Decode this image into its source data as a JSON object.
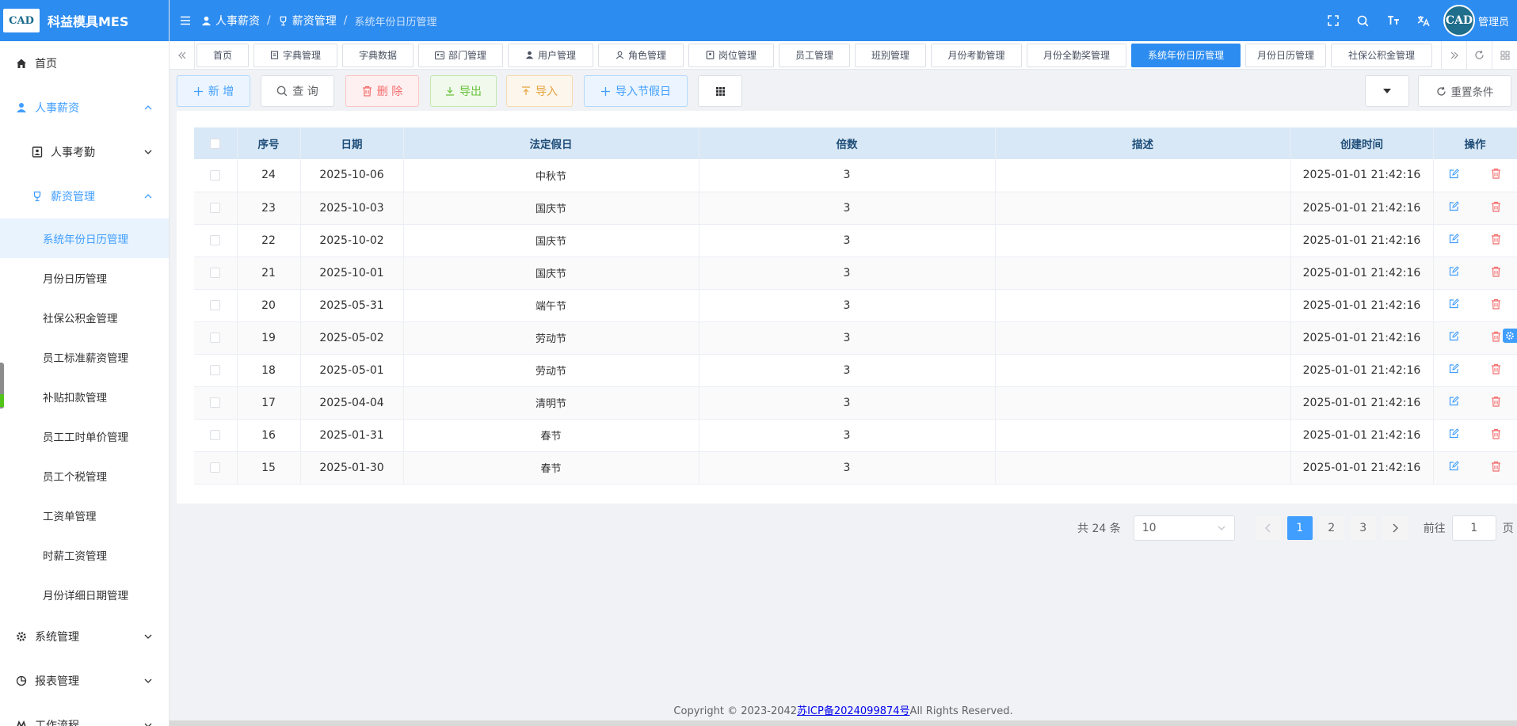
{
  "app": {
    "title": "科益模具MES",
    "logo_text": "CAD"
  },
  "sidebar": {
    "home": "首页",
    "hr_salary": "人事薪资",
    "hr_attendance": "人事考勤",
    "salary_mgmt": "薪资管理",
    "leaves": [
      "系统年份日历管理",
      "月份日历管理",
      "社保公积金管理",
      "员工标准薪资管理",
      "补贴扣款管理",
      "员工工时单价管理",
      "员工个税管理",
      "工资单管理",
      "时薪工资管理",
      "月份详细日期管理"
    ],
    "system_mgmt": "系统管理",
    "report_mgmt": "报表管理",
    "workflow": "工作流程"
  },
  "header": {
    "breadcrumb": [
      "人事薪资",
      "薪资管理",
      "系统年份日历管理"
    ],
    "admin": "管理员",
    "avatar_text": "CAD"
  },
  "tags": [
    "首页",
    "字典管理",
    "字典数据",
    "部门管理",
    "用户管理",
    "角色管理",
    "岗位管理",
    "员工管理",
    "班别管理",
    "月份考勤管理",
    "月份全勤奖管理",
    "系统年份日历管理",
    "月份日历管理",
    "社保公积金管理"
  ],
  "toolbar": {
    "add": "新 增",
    "query": "查 询",
    "delete": "删 除",
    "export": "导出",
    "import": "导入",
    "import_holiday": "导入节假日",
    "reset": "重置条件"
  },
  "table": {
    "columns": [
      "序号",
      "日期",
      "法定假日",
      "倍数",
      "描述",
      "创建时间",
      "操作"
    ],
    "rows": [
      {
        "no": "24",
        "date": "2025-10-06",
        "holiday": "中秋节",
        "mult": "3",
        "desc": "",
        "created": "2025-01-01 21:42:16"
      },
      {
        "no": "23",
        "date": "2025-10-03",
        "holiday": "国庆节",
        "mult": "3",
        "desc": "",
        "created": "2025-01-01 21:42:16"
      },
      {
        "no": "22",
        "date": "2025-10-02",
        "holiday": "国庆节",
        "mult": "3",
        "desc": "",
        "created": "2025-01-01 21:42:16"
      },
      {
        "no": "21",
        "date": "2025-10-01",
        "holiday": "国庆节",
        "mult": "3",
        "desc": "",
        "created": "2025-01-01 21:42:16"
      },
      {
        "no": "20",
        "date": "2025-05-31",
        "holiday": "端午节",
        "mult": "3",
        "desc": "",
        "created": "2025-01-01 21:42:16"
      },
      {
        "no": "19",
        "date": "2025-05-02",
        "holiday": "劳动节",
        "mult": "3",
        "desc": "",
        "created": "2025-01-01 21:42:16"
      },
      {
        "no": "18",
        "date": "2025-05-01",
        "holiday": "劳动节",
        "mult": "3",
        "desc": "",
        "created": "2025-01-01 21:42:16"
      },
      {
        "no": "17",
        "date": "2025-04-04",
        "holiday": "清明节",
        "mult": "3",
        "desc": "",
        "created": "2025-01-01 21:42:16"
      },
      {
        "no": "16",
        "date": "2025-01-31",
        "holiday": "春节",
        "mult": "3",
        "desc": "",
        "created": "2025-01-01 21:42:16"
      },
      {
        "no": "15",
        "date": "2025-01-30",
        "holiday": "春节",
        "mult": "3",
        "desc": "",
        "created": "2025-01-01 21:42:16"
      }
    ]
  },
  "pager": {
    "total": "共 24 条",
    "page_size": "10",
    "pages": [
      "1",
      "2",
      "3"
    ],
    "current": "1",
    "goto_label": "前往",
    "goto_value": "1",
    "page_unit": "页"
  },
  "footer": {
    "prefix": "Copyright © 2023-2042",
    "icp": "苏ICP备2024099874号",
    "suffix": "All Rights Reserved."
  },
  "colors": {
    "primary": "#2d8cf0",
    "accent": "#409eff",
    "danger": "#f56c6c",
    "success": "#67c23a",
    "warning": "#e6a23c"
  }
}
